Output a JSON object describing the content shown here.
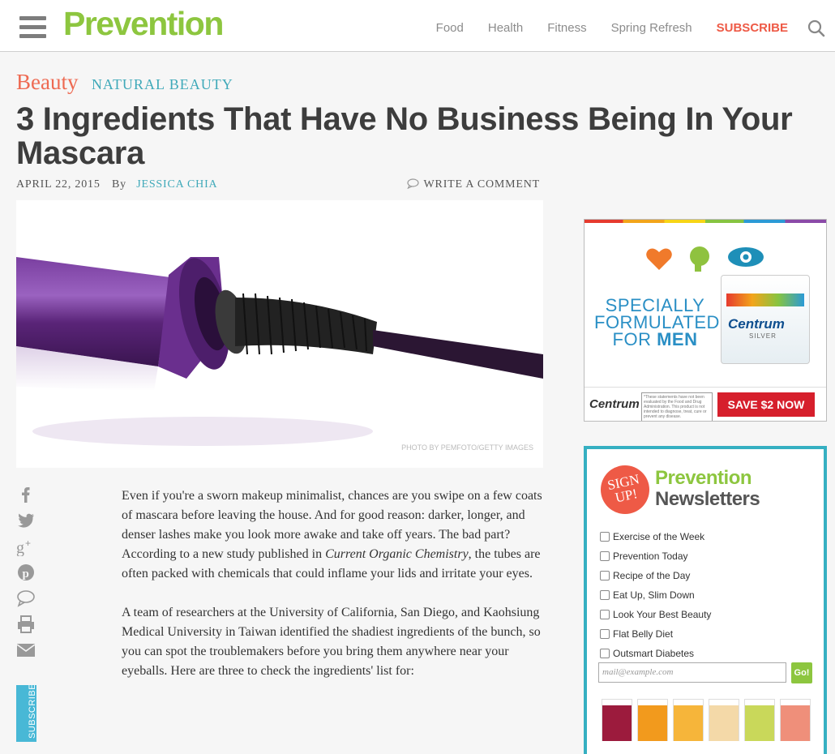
{
  "header": {
    "logo": "Prevention",
    "nav": [
      "Food",
      "Health",
      "Fitness",
      "Spring Refresh"
    ],
    "subscribe": "SUBSCRIBE"
  },
  "article": {
    "category": "Beauty",
    "subcategory": "NATURAL BEAUTY",
    "title": "3 Ingredients That Have No Business Being In Your Mascara",
    "date": "APRIL 22, 2015",
    "by": "By",
    "author": "JESSICA CHIA",
    "comment_link": "WRITE A COMMENT",
    "photo_credit": "PHOTO BY PEMFOTO/GETTY IMAGES",
    "para1_a": "Even if you're a sworn makeup minimalist, chances are you swipe on a few coats of mascara before leaving the house. And for good reason: darker, longer, and denser lashes make you look more awake and take off years. The bad part? According to a new study published in ",
    "para1_em": "Current Organic Chemistry",
    "para1_b": ", the tubes are often packed with chemicals that could inflame your lids and irritate your eyes.",
    "para2": "A team of researchers at the University of California, San Diego, and Kaohsiung Medical University in Taiwan identified the shadiest ingredients of the bunch, so you can spot the troublemakers before you bring them anywhere near your eyeballs. Here are three to check the ingredients' list for:"
  },
  "share": {
    "icons": [
      "facebook-icon",
      "twitter-icon",
      "google-plus-icon",
      "pinterest-icon",
      "comment-icon",
      "print-icon",
      "email-icon"
    ],
    "subscribe_tab": "SUBSCRIBE"
  },
  "ad": {
    "headline": "SPECIALLY FORMULATED FOR",
    "headline_bold": "MEN",
    "brand": "Centrum",
    "product": "Centrum",
    "product_sub": "SILVER",
    "disclaimer": "*These statements have not been evaluated by the Food and Drug Administration. This product is not intended to diagnose, treat, cure or prevent any disease.",
    "cta": "SAVE $2 NOW"
  },
  "newsletter": {
    "badge": "SIGN UP!",
    "brand": "Prevention",
    "title": "Newsletters",
    "items": [
      "Exercise of the Week",
      "Prevention Today",
      "Recipe of the Day",
      "Eat Up, Slim Down",
      "Look Your Best Beauty",
      "Flat Belly Diet",
      "Outsmart Diabetes"
    ],
    "email_placeholder": "mail@example.com",
    "go": "Go!"
  },
  "colors": {
    "brand_green": "#8dc63f",
    "accent_red": "#ee5a46",
    "teal": "#3fa9b9"
  }
}
